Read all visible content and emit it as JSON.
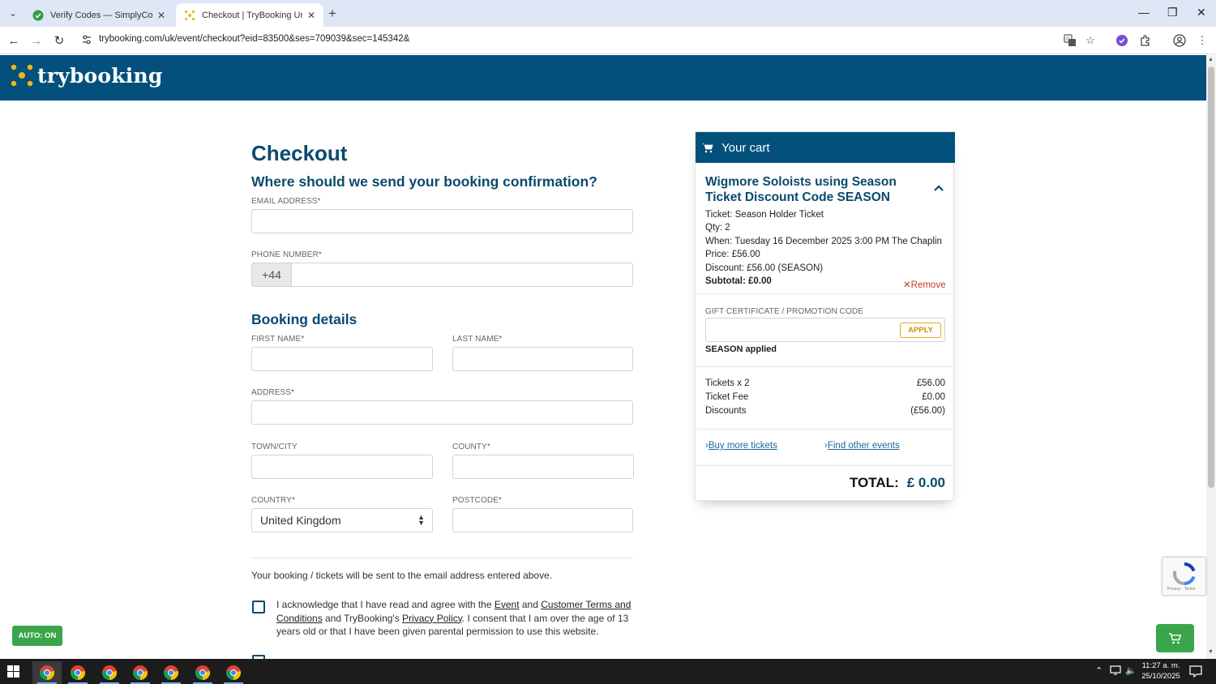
{
  "browser": {
    "tabs": [
      {
        "title": "Verify Codes — SimplyCodes",
        "active": false
      },
      {
        "title": "Checkout | TryBooking United K",
        "active": true
      }
    ],
    "url": "trybooking.com/uk/event/checkout?eid=83500&ses=709039&sec=145342&"
  },
  "site": {
    "logo_text": "trybooking",
    "brand_color": "#03507c"
  },
  "checkout": {
    "title": "Checkout",
    "confirmation_heading": "Where should we send your booking confirmation?",
    "email_label": "EMAIL ADDRESS",
    "email_value": "",
    "phone_label": "PHONE NUMBER",
    "phone_prefix": "+44",
    "phone_value": "",
    "booking_heading": "Booking details",
    "first_name_label": "FIRST NAME",
    "last_name_label": "LAST NAME",
    "address_label": "ADDRESS",
    "town_label": "TOWN/CITY",
    "county_label": "COUNTY",
    "country_label": "COUNTRY",
    "country_value": "United Kingdom",
    "postcode_label": "POSTCODE",
    "required_mark": "*",
    "notice": "Your booking / tickets will be sent to the email address entered above.",
    "ack": {
      "part1": "I acknowledge that I have read and agree with the ",
      "event_link": "Event",
      "part2": " and ",
      "terms_link": "Customer Terms and Conditions",
      "part3": " and TryBooking's ",
      "privacy_link": "Privacy Policy",
      "part4": ". I consent that I am over the age of 13 years old or that I have been given parental permission to use this website."
    }
  },
  "cart": {
    "heading": "Your cart",
    "event_title": "Wigmore Soloists using Season Ticket Discount Code SEASON",
    "ticket": "Ticket: Season Holder Ticket",
    "qty": "Qty: 2",
    "when": "When: Tuesday 16 December 2025 3:00 PM The Chaplin",
    "price": "Price: £56.00",
    "discount": "Discount: £56.00 (SEASON)",
    "subtotal": "Subtotal: £0.00",
    "remove": "Remove",
    "promo_label": "GIFT CERTIFICATE / PROMOTION CODE",
    "promo_value": "",
    "apply": "APPLY",
    "applied": "SEASON applied",
    "summary": [
      {
        "label": "Tickets x 2",
        "value": "£56.00"
      },
      {
        "label": "Ticket Fee",
        "value": "£0.00"
      },
      {
        "label": "Discounts",
        "value": "(£56.00)"
      }
    ],
    "buy_more": "Buy more tickets",
    "find_other": "Find other events",
    "total_label": "TOTAL:",
    "total_value": "£ 0.00"
  },
  "widgets": {
    "auto_badge": "AUTO: ON",
    "recaptcha_small": "Privacy - Terms"
  },
  "taskbar": {
    "time": "11:27 a. m.",
    "date": "25/10/2025"
  }
}
